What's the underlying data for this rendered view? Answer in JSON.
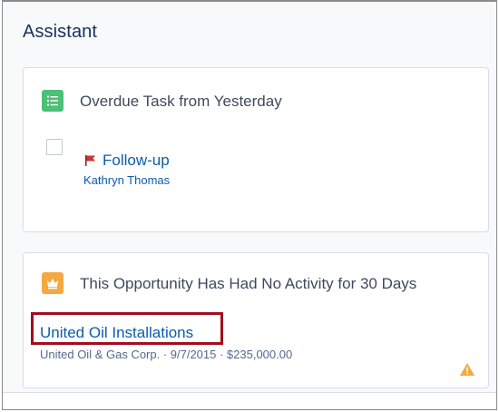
{
  "header": {
    "title": "Assistant"
  },
  "cards": [
    {
      "icon": "task-list-icon",
      "title": "Overdue Task from Yesterday",
      "task": {
        "checked": false,
        "priority_icon": "flag-icon",
        "subject": "Follow-up",
        "owner": "Kathryn Thomas"
      }
    },
    {
      "icon": "opportunity-crown-icon",
      "title": "This Opportunity Has Had No Activity for 30 Days",
      "record": {
        "name": "United Oil Installations",
        "meta": "United Oil & Gas Corp. · 9/7/2015 · $235,000.00"
      },
      "warning_icon": "warning-icon"
    }
  ],
  "colors": {
    "task_icon_bg": "#4bc076",
    "opportunity_icon_bg": "#f4a940",
    "link": "#0b5cab",
    "highlight_border": "#a10d1f",
    "warning": "#f4a940",
    "flag": "#c23934"
  }
}
